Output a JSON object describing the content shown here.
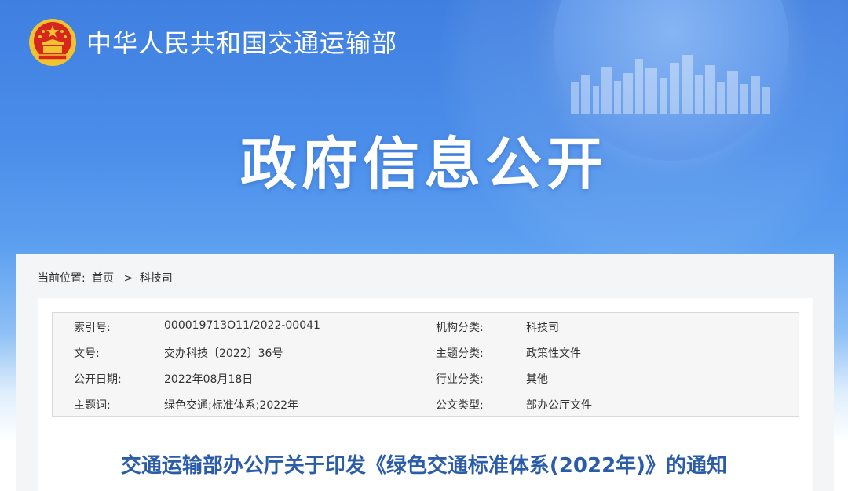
{
  "header": {
    "ministry_name": "中华人民共和国交通运输部",
    "section_title": "政府信息公开"
  },
  "breadcrumb": {
    "prefix": "当前位置:",
    "home": "首页",
    "separator": ">",
    "current": "科技司"
  },
  "meta": {
    "rows": [
      {
        "label1": "索引号:",
        "value1": "000019713O11/2022-00041",
        "label2": "机构分类:",
        "value2": "科技司"
      },
      {
        "label1": "文号:",
        "value1": "交办科技〔2022〕36号",
        "label2": "主题分类:",
        "value2": "政策性文件"
      },
      {
        "label1": "公开日期:",
        "value1": "2022年08月18日",
        "label2": "行业分类:",
        "value2": "其他"
      },
      {
        "label1": "主题词:",
        "value1": "绿色交通;标准体系;2022年",
        "label2": "公文类型:",
        "value2": "部办公厅文件"
      }
    ]
  },
  "document": {
    "title": "交通运输部办公厅关于印发《绿色交通标准体系(2022年)》的通知"
  },
  "colors": {
    "banner_blue": "#4b8eea",
    "title_blue": "#2a5caa",
    "emblem_red": "#d7261e",
    "emblem_gold": "#f2c230"
  },
  "icons": {
    "emblem": "national-emblem-icon",
    "skyline": "city-skyline-icon"
  }
}
